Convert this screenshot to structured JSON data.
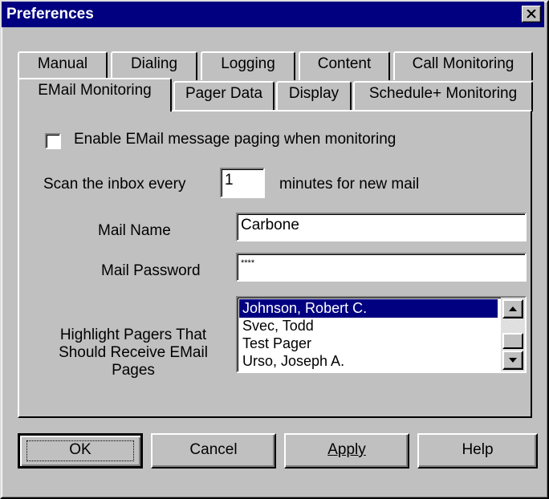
{
  "window": {
    "title": "Preferences"
  },
  "tabs": {
    "row1": [
      "Manual",
      "Dialing",
      "Logging",
      "Content",
      "Call Monitoring"
    ],
    "row2": [
      "EMail Monitoring",
      "Pager Data",
      "Display",
      "Schedule+ Monitoring"
    ],
    "active": "EMail Monitoring"
  },
  "email": {
    "enable_label": "Enable EMail message paging when monitoring",
    "enable_checked": false,
    "scan_prefix": "Scan the inbox every",
    "scan_value": "1",
    "scan_suffix": "minutes for new mail",
    "mail_name_label": "Mail Name",
    "mail_name_value": "Carbone",
    "mail_password_label": "Mail Password",
    "mail_password_value": "****",
    "pagers_label_lines": [
      "Highlight Pagers That",
      "Should Receive EMail",
      "Pages"
    ],
    "pagers": [
      {
        "name": "Johnson, Robert C.",
        "selected": true
      },
      {
        "name": "Svec, Todd",
        "selected": false
      },
      {
        "name": "Test Pager",
        "selected": false
      },
      {
        "name": "Urso, Joseph A.",
        "selected": false
      }
    ]
  },
  "buttons": {
    "ok": "OK",
    "cancel": "Cancel",
    "apply": "Apply",
    "help": "Help"
  }
}
